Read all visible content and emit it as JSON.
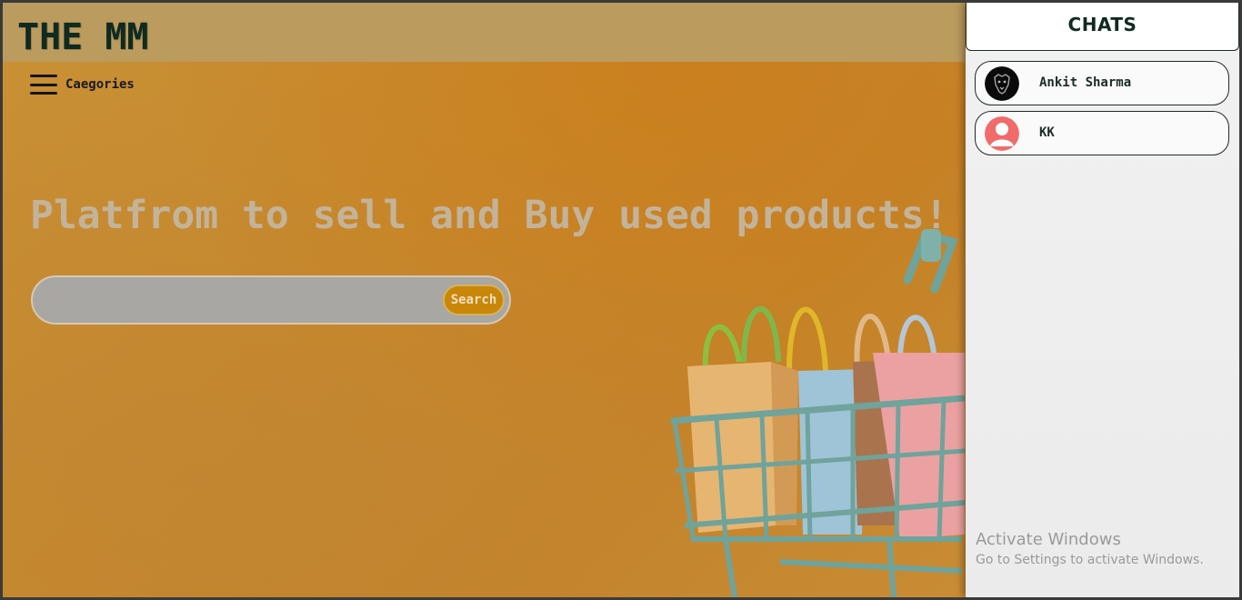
{
  "header": {
    "brand": "THE MM"
  },
  "nav": {
    "categories_label": "Caegories"
  },
  "hero": {
    "headline": "Platfrom to sell and Buy used products!",
    "search_placeholder": "",
    "search_value": "",
    "search_button": "Search"
  },
  "chats": {
    "title": "CHATS",
    "items": [
      {
        "name": "Ankit Sharma",
        "avatar": "lion-avatar-icon"
      },
      {
        "name": "KK",
        "avatar": "default-user-avatar-icon"
      }
    ]
  },
  "watermark": {
    "line1": "Activate Windows",
    "line2": "Go to Settings to activate Windows."
  },
  "colors": {
    "brand_text": "#0f2a20",
    "topbar": "#bb9b5e",
    "search_button": "#c9870a",
    "avatar_default": "#f26b6b"
  }
}
